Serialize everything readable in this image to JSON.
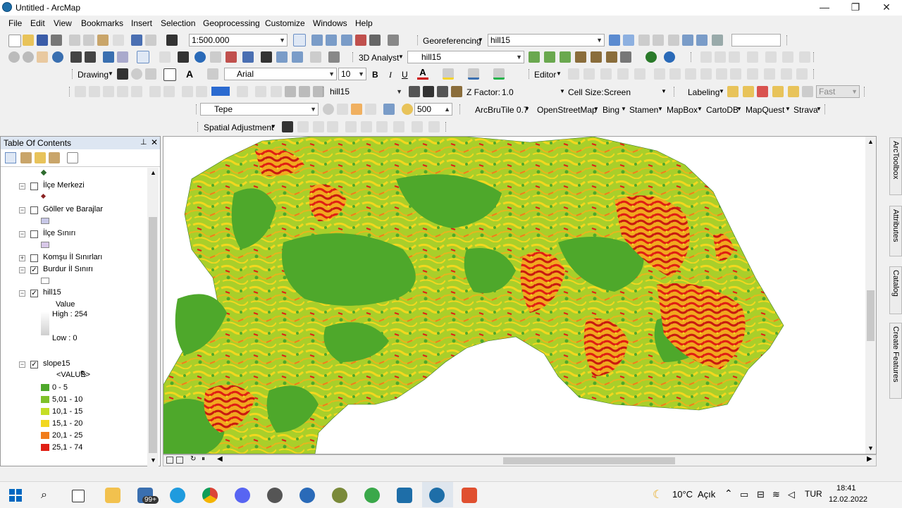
{
  "window": {
    "title": "Untitled - ArcMap",
    "minimize": "—",
    "maximize": "❐",
    "close": "✕"
  },
  "menu": [
    "File",
    "Edit",
    "View",
    "Bookmarks",
    "Insert",
    "Selection",
    "Geoprocessing",
    "Customize",
    "Windows",
    "Help"
  ],
  "toolbar1": {
    "scale": "1:500.000",
    "georef_label": "Georeferencing",
    "georef_layer": "hill15"
  },
  "toolbar2": {
    "analyst_label": "3D Analyst",
    "analyst_layer": "hill15"
  },
  "toolbar3": {
    "drawing_label": "Drawing",
    "font": "Arial",
    "size": "10",
    "bold": "B",
    "italic": "I",
    "underline": "U",
    "text_tool": "A",
    "editor_label": "Editor"
  },
  "toolbar4": {
    "layer": "hill15",
    "zfactor_label": "Z Factor:",
    "zfactor": "1.0",
    "cellsize_label": "Cell Size:",
    "cellsize": "Screen",
    "labeling_label": "Labeling",
    "quality": "Fast"
  },
  "toolbar5": {
    "layer": "Tepe",
    "distance": "500",
    "basemaps": [
      "ArcBruTile 0.7",
      "OpenStreetMap",
      "Bing",
      "Stamen",
      "MapBox",
      "CartoDB",
      "MapQuest",
      "Strava"
    ]
  },
  "toolbar6": {
    "spatial_adjustment": "Spatial Adjustment"
  },
  "toc": {
    "title": "Table Of Contents",
    "layers": [
      {
        "name": "İlçe Merkezi",
        "checked": false
      },
      {
        "name": "Göller ve Barajlar",
        "checked": false
      },
      {
        "name": "İlçe Sınırı",
        "checked": false
      },
      {
        "name": "Komşu İl Sınırları",
        "checked": false
      },
      {
        "name": "Burdur İl Sınırı",
        "checked": true
      },
      {
        "name": "hill15",
        "checked": true
      },
      {
        "name": "slope15",
        "checked": true
      }
    ],
    "hill": {
      "field": "Value",
      "high": "High : 254",
      "low": "Low : 0"
    },
    "slope": {
      "field": "<VALUE>",
      "classes": [
        "0 - 5",
        "5,01 - 10",
        "10,1 - 15",
        "15,1 - 20",
        "20,1 - 25",
        "25,1 - 74"
      ]
    }
  },
  "colors": {
    "c1": "#4ea82b",
    "c2": "#7fc12a",
    "c3": "#c5de26",
    "c4": "#f2d71f",
    "c5": "#f07c1b",
    "c6": "#e01f14"
  },
  "dock": [
    "ArcToolbox",
    "Attributes",
    "Catalog",
    "Create Features"
  ],
  "taskbar": {
    "badge": "99+",
    "weather": "10°C",
    "weather_desc": "Açık",
    "lang": "TUR",
    "time": "18:41",
    "date": "12.02.2022"
  }
}
